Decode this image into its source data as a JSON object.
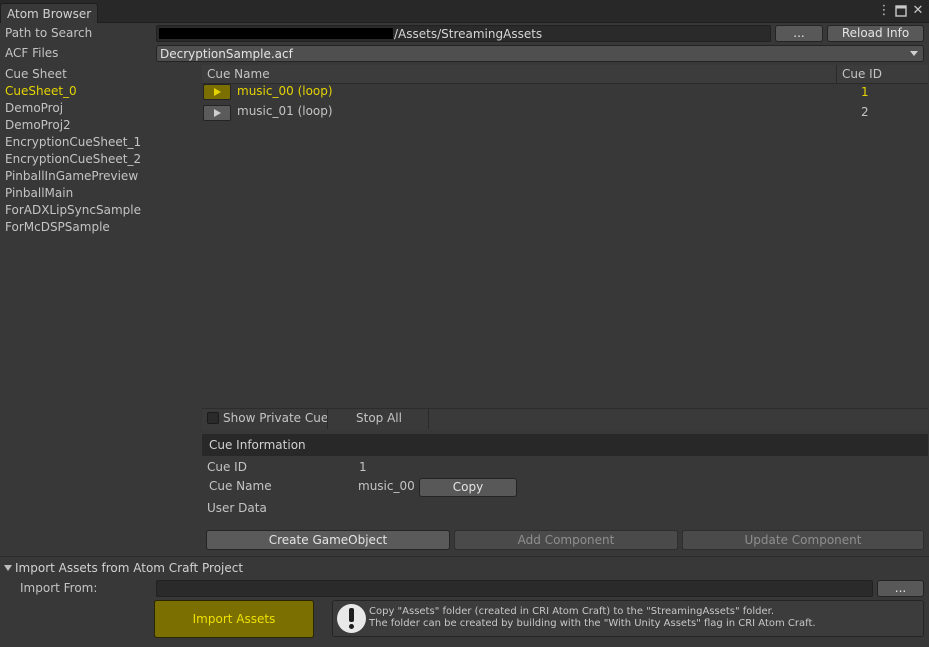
{
  "window": {
    "tab_title": "Atom Browser"
  },
  "path_row": {
    "label": "Path to Search",
    "value": "/Assets/StreamingAssets",
    "browse_label": "...",
    "reload_label": "Reload Info"
  },
  "acf_row": {
    "label": "ACF Files",
    "selected": "DecryptionSample.acf"
  },
  "cue_sheets": {
    "header": "Cue Sheet",
    "items": [
      "CueSheet_0",
      "DemoProj",
      "DemoProj2",
      "EncryptionCueSheet_1",
      "EncryptionCueSheet_2",
      "PinballInGamePreview",
      "PinballMain",
      "ForADXLipSyncSample",
      "ForMcDSPSample"
    ],
    "selected_index": 0
  },
  "cue_table": {
    "columns": {
      "name": "Cue Name",
      "id": "Cue ID"
    },
    "rows": [
      {
        "name": "music_00 (loop)",
        "id": "1"
      },
      {
        "name": "music_01 (loop)",
        "id": "2"
      }
    ]
  },
  "controls": {
    "show_private_label": "Show Private Cue",
    "stop_all_label": "Stop All"
  },
  "cue_info": {
    "header": "Cue Information",
    "id_label": "Cue ID",
    "id_value": "1",
    "name_label": "Cue Name",
    "name_value": "music_00",
    "copy_label": "Copy",
    "user_data_label": "User Data"
  },
  "actions": {
    "create_label": "Create GameObject",
    "add_label": "Add Component",
    "update_label": "Update Component"
  },
  "import": {
    "header": "Import Assets from Atom Craft Project",
    "from_label": "Import From:",
    "from_value": "",
    "browse_label": "...",
    "import_label": "Import Assets",
    "help_line1": "Copy \"Assets\" folder (created in CRI Atom Craft) to the \"StreamingAssets\" folder.",
    "help_line2": "The folder can be created by building with the \"With Unity Assets\" flag in CRI Atom Craft."
  },
  "colors": {
    "accent": "#e6d400",
    "panel": "#383838",
    "dark": "#282828"
  }
}
